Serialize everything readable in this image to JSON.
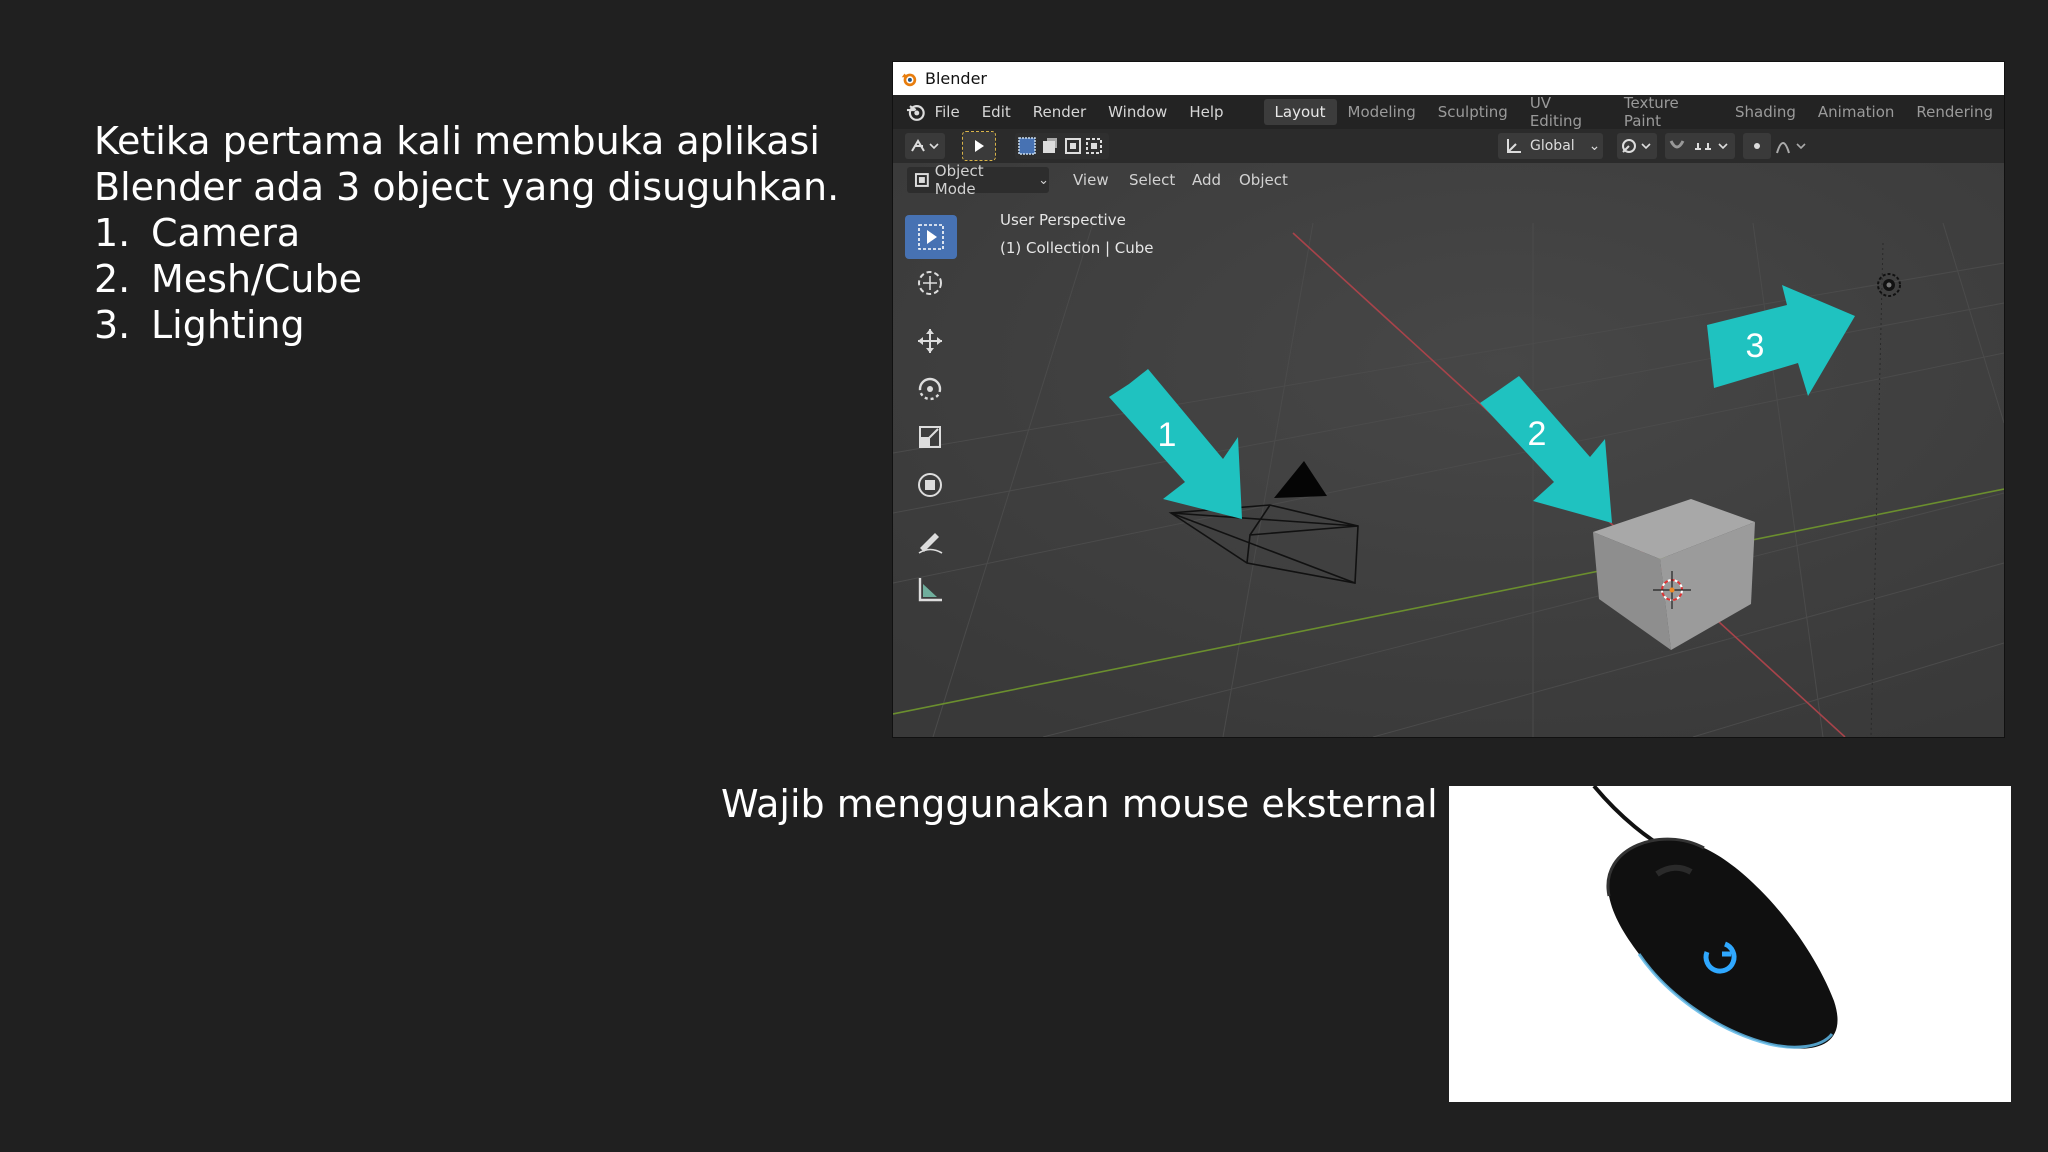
{
  "intro": {
    "line1": "Ketika pertama kali membuka aplikasi",
    "line2": "Blender ada 3 object yang disuguhkan.",
    "items": [
      {
        "num": "1.",
        "label": "Camera"
      },
      {
        "num": "2.",
        "label": "Mesh/Cube"
      },
      {
        "num": "3.",
        "label": "Lighting"
      }
    ]
  },
  "caption": "Wajib menggunakan mouse eksternal",
  "blender": {
    "title": "Blender",
    "menu": [
      "File",
      "Edit",
      "Render",
      "Window",
      "Help"
    ],
    "workspaces": [
      "Layout",
      "Modeling",
      "Sculpting",
      "UV Editing",
      "Texture Paint",
      "Shading",
      "Animation",
      "Rendering"
    ],
    "active_workspace": "Layout",
    "transform_orientation": "Global",
    "mode": "Object Mode",
    "header_menu": [
      "View",
      "Select",
      "Add",
      "Object"
    ],
    "viewport_label": "User Perspective",
    "viewport_collection": "(1) Collection | Cube",
    "markers": [
      "1",
      "2",
      "3"
    ],
    "accent_color": "#1fc2c0",
    "active_tool_color": "#4772b3"
  }
}
